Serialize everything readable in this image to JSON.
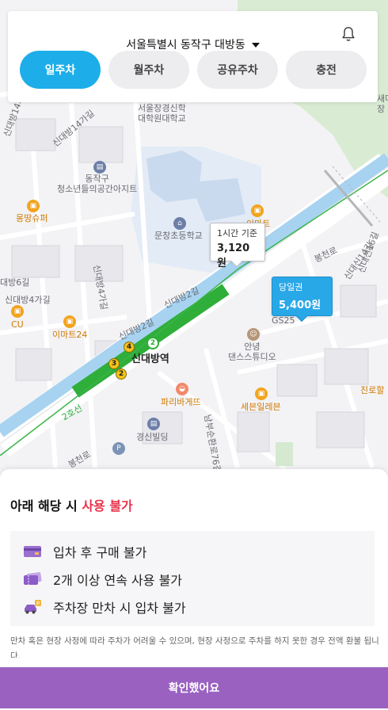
{
  "header": {
    "location": "서울특별시 동작구 대방동",
    "tabs": [
      {
        "label": "일주차",
        "active": true
      },
      {
        "label": "월주차",
        "active": false
      },
      {
        "label": "공유주차",
        "active": false
      },
      {
        "label": "충전",
        "active": false
      }
    ],
    "notification_icon": "bell-icon"
  },
  "map": {
    "labels": {
      "university": "서울장경신학\n대학원대학교",
      "youth_space": "동작구\n청소년들의공간아지트",
      "school": "문창초등학교",
      "mart_mongttang": "몽땅슈퍼",
      "cu": "CU",
      "emart24": "이마트24",
      "station": "신대방역",
      "paris": "파리바게뜨",
      "seven": "세븐일레븐",
      "dance": "안녕\n댄스스튜디오",
      "gyeongsin": "경신빌딩",
      "gs25": "GS25",
      "jinro": "진로할",
      "saesil": "새마을\n장",
      "line2": "2호선",
      "road_14": "신대방14가길",
      "road_14b": "신대방14가길",
      "road_6": "대방6길",
      "road_4": "신대방4가길",
      "road_2": "신대방2길",
      "road_2b": "신대방2길",
      "road_4b": "신대방4가길",
      "road_16": "신대신16길",
      "road_14c": "신대신14길",
      "bongcheon": "봉천로",
      "bongcheon2": "봉천로",
      "nambu": "남부순환로76길",
      "mart_top": "이마트"
    },
    "station_markers": [
      "4",
      "2",
      "3",
      "2"
    ],
    "price_tags": [
      {
        "sub": "1시간 기준",
        "value": "3,120원",
        "highlight": false
      },
      {
        "sub": "당일권",
        "value": "5,400원",
        "highlight": true
      }
    ]
  },
  "sheet": {
    "title_prefix": "아래 해당 시 ",
    "title_warn": "사용 불가",
    "rules": [
      {
        "icon": "card-icon",
        "text": "입차 후 구매 불가"
      },
      {
        "icon": "ticket-icon",
        "text": "2개 이상 연속 사용 불가"
      },
      {
        "icon": "car-parking-icon",
        "text": "주차장 만차 시 입차 불가"
      }
    ],
    "note": "만차 혹은 현장 사정에 따라 주차가 어려울 수 있으며, 현장 사정으로 주차를 하지 못한 경우 전액 환불 됩니다.",
    "confirm_label": "확인했어요"
  },
  "colors": {
    "accent": "#1daee9",
    "warn": "#e8334a",
    "confirm": "#9a61c1",
    "line2": "#2fae3a",
    "stream": "#a7d3f1"
  }
}
